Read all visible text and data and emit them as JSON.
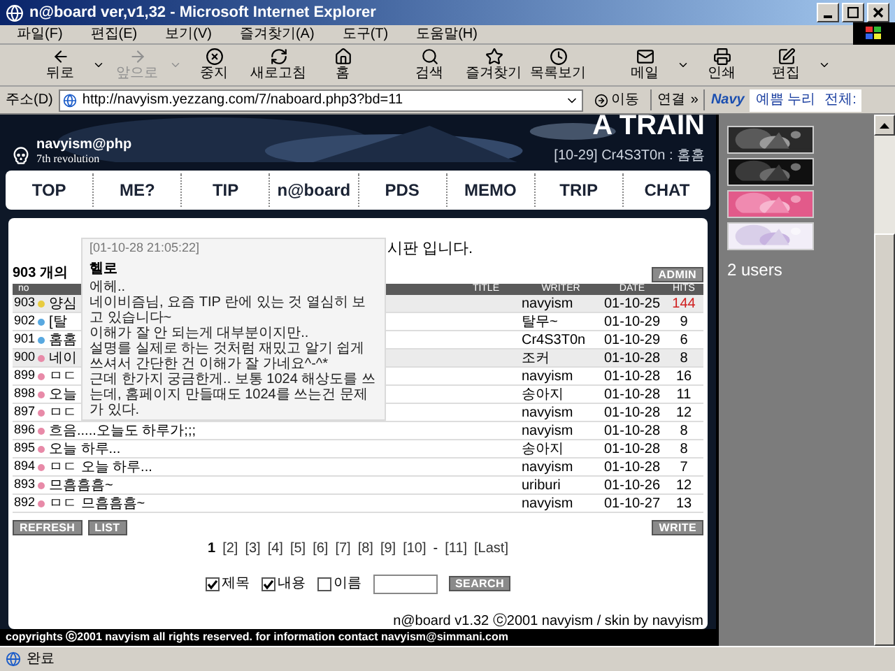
{
  "window": {
    "title": "n@board ver,v1,32 - Microsoft Internet Explorer"
  },
  "menu": [
    "파일(F)",
    "편집(E)",
    "보기(V)",
    "즐겨찾기(A)",
    "도구(T)",
    "도움말(H)"
  ],
  "toolbar": [
    {
      "label": "뒤로",
      "disabled": false,
      "dropdown": true
    },
    {
      "label": "앞으로",
      "disabled": true,
      "dropdown": true
    },
    {
      "label": "중지",
      "disabled": false,
      "dropdown": false
    },
    {
      "label": "새로고침",
      "disabled": false,
      "dropdown": false
    },
    {
      "label": "홈",
      "disabled": false,
      "dropdown": false
    },
    {
      "label": "검색",
      "disabled": false,
      "dropdown": false
    },
    {
      "label": "즐겨찾기",
      "disabled": false,
      "dropdown": false
    },
    {
      "label": "목록보기",
      "disabled": false,
      "dropdown": false
    },
    {
      "label": "메일",
      "disabled": false,
      "dropdown": true
    },
    {
      "label": "인쇄",
      "disabled": false,
      "dropdown": false
    },
    {
      "label": "편집",
      "disabled": false,
      "dropdown": true
    }
  ],
  "address_bar": {
    "label": "주소(D)",
    "url": "http://navyism.yezzang.com/7/naboard.php3?bd=11",
    "go": "이동",
    "links": "연결",
    "more": "»",
    "navy_logo": "Navy",
    "navy_field": "예쁨 누리",
    "navy_label": "전체:"
  },
  "header": {
    "title": "A TRAIN",
    "site": "navyism@php",
    "subtitle": "7th revolution",
    "latest": "[10-29] Cr4S3T0n : 홈홈"
  },
  "nav": [
    "TOP",
    "ME?",
    "TIP",
    "n@board",
    "PDS",
    "MEMO",
    "TRIP",
    "CHAT"
  ],
  "board": {
    "description": "시판 입니다.",
    "count": "903 개의",
    "admin": "ADMIN",
    "columns": [
      "no",
      "TITLE",
      "WRITER",
      "DATE",
      "HITS"
    ],
    "rows": [
      {
        "no": "903",
        "title": "양심",
        "color": "#e8cc40",
        "writer": "navyism",
        "date": "01-10-25",
        "hits": "144",
        "selected": true,
        "hot": true
      },
      {
        "no": "902",
        "title": "[탈",
        "color": "#58a8e0",
        "writer": "탈무~",
        "date": "01-10-29",
        "hits": "9",
        "selected": false,
        "hot": false
      },
      {
        "no": "901",
        "title": "홈홈",
        "color": "#58a8e0",
        "writer": "Cr4S3T0n",
        "date": "01-10-29",
        "hits": "6",
        "selected": false,
        "hot": false
      },
      {
        "no": "900",
        "title": "네이",
        "color": "#e88aa8",
        "writer": "조커",
        "date": "01-10-28",
        "hits": "8",
        "selected": true,
        "hot": false
      },
      {
        "no": "899",
        "title": "ㅁㄷ",
        "color": "#e88aa8",
        "writer": "navyism",
        "date": "01-10-28",
        "hits": "16",
        "selected": false,
        "hot": false
      },
      {
        "no": "898",
        "title": "오늘",
        "color": "#e88aa8",
        "writer": "송아지",
        "date": "01-10-28",
        "hits": "11",
        "selected": false,
        "hot": false
      },
      {
        "no": "897",
        "title": "ㅁㄷ",
        "color": "#e88aa8",
        "writer": "navyism",
        "date": "01-10-28",
        "hits": "12",
        "selected": false,
        "hot": false
      },
      {
        "no": "896",
        "title": "흐음.....오늘도 하루가;;;",
        "color": "#e88aa8",
        "writer": "navyism",
        "date": "01-10-28",
        "hits": "8",
        "selected": false,
        "hot": false
      },
      {
        "no": "895",
        "title": "오늘 하루...",
        "color": "#e88aa8",
        "writer": "송아지",
        "date": "01-10-28",
        "hits": "8",
        "selected": false,
        "hot": false
      },
      {
        "no": "894",
        "title": "ㅁㄷ 오늘 하루...",
        "color": "#e88aa8",
        "writer": "navyism",
        "date": "01-10-28",
        "hits": "7",
        "selected": false,
        "hot": false
      },
      {
        "no": "893",
        "title": "므흠흠흠~",
        "color": "#e88aa8",
        "writer": "uriburi",
        "date": "01-10-26",
        "hits": "12",
        "selected": false,
        "hot": false
      },
      {
        "no": "892",
        "title": "ㅁㄷ 므흠흠흠~",
        "color": "#e88aa8",
        "writer": "navyism",
        "date": "01-10-27",
        "hits": "13",
        "selected": false,
        "hot": false
      }
    ],
    "buttons_left": [
      "REFRESH",
      "LIST"
    ],
    "button_write": "WRITE",
    "pages": [
      {
        "kind": "page",
        "label": "1",
        "selected": true
      },
      {
        "kind": "page",
        "label": "[2]",
        "selected": false
      },
      {
        "kind": "page",
        "label": "[3]",
        "selected": false
      },
      {
        "kind": "page",
        "label": "[4]",
        "selected": false
      },
      {
        "kind": "page",
        "label": "[5]",
        "selected": false
      },
      {
        "kind": "page",
        "label": "[6]",
        "selected": false
      },
      {
        "kind": "page",
        "label": "[7]",
        "selected": false
      },
      {
        "kind": "page",
        "label": "[8]",
        "selected": false
      },
      {
        "kind": "page",
        "label": "[9]",
        "selected": false
      },
      {
        "kind": "page",
        "label": "[10]",
        "selected": false
      },
      {
        "kind": "separator",
        "label": "-"
      },
      {
        "kind": "page",
        "label": "[11]",
        "selected": false
      },
      {
        "kind": "page",
        "label": "[Last]",
        "selected": false
      }
    ],
    "search_options": [
      {
        "label": "제목",
        "checked": true
      },
      {
        "label": "내용",
        "checked": true
      },
      {
        "label": "이름",
        "checked": false
      }
    ],
    "search_button": "SEARCH",
    "credit": "n@board v1.32 ⓒ2001 navyism / skin by navyism",
    "tooltip": {
      "date": "[01-10-28 21:05:22]",
      "title": "헬로",
      "lines": [
        "에헤..",
        "네이비즘님, 요즘 TIP 란에 있는 것 열심히 보고 있습니다~",
        "이해가 잘 안 되는게 대부분이지만..",
        "설명를 실제로 하는 것처럼 재밌고 알기 쉽게 쓰셔서 간단한 건 이해가 잘 가네요^-^*",
        "근데 한가지 궁금한게.. 보통 1024 해상도를 쓰는데, 홈페이지 만들때도 1024를 쓰는건 문제가 있다."
      ]
    }
  },
  "footer": "copyrights ⓒ2001 navyism all rights reserved. for information contact navyism@simmani.com",
  "sidebar": {
    "users": "2 users"
  },
  "status_bar": {
    "text": "완료"
  }
}
